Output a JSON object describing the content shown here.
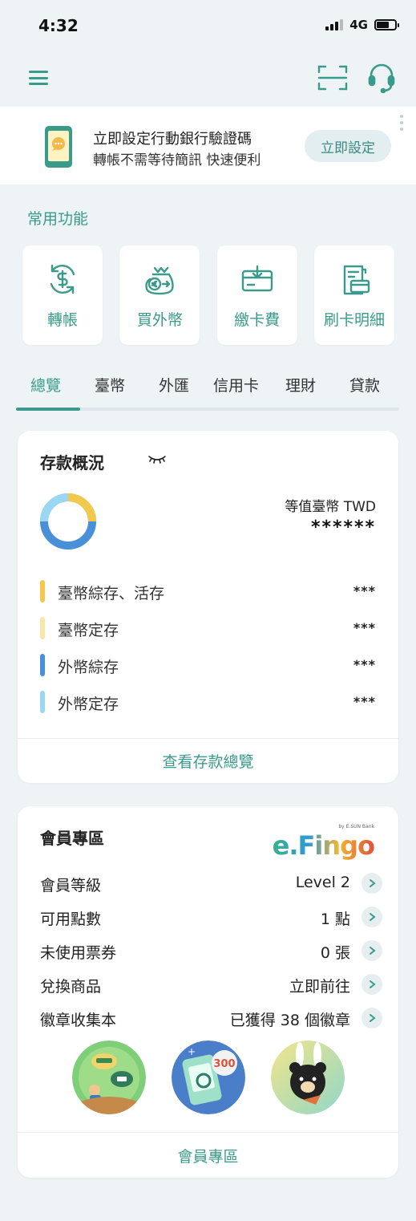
{
  "status_bar": {
    "time": "4:32",
    "network": "4G"
  },
  "banner": {
    "title": "立即設定行動銀行驗證碼",
    "subtitle": "轉帳不需等待簡訊 快速便利",
    "button": "立即設定"
  },
  "quick_functions": {
    "title": "常用功能",
    "items": [
      {
        "label": "轉帳",
        "icon": "transfer-dollar-icon"
      },
      {
        "label": "買外幣",
        "icon": "foreign-currency-icon"
      },
      {
        "label": "繳卡費",
        "icon": "pay-card-fee-icon"
      },
      {
        "label": "刷卡明細",
        "icon": "card-statement-icon"
      }
    ]
  },
  "tabs": [
    {
      "label": "總覽",
      "active": true
    },
    {
      "label": "臺幣"
    },
    {
      "label": "外匯"
    },
    {
      "label": "信用卡"
    },
    {
      "label": "理財"
    },
    {
      "label": "貸款"
    }
  ],
  "deposit": {
    "title": "存款概況",
    "currency_label": "等值臺幣 TWD",
    "total": "******",
    "rows": [
      {
        "label": "臺幣綜存、活存",
        "value": "***",
        "color": "#f2c94c"
      },
      {
        "label": "臺幣定存",
        "value": "***",
        "color": "#f8e7a8"
      },
      {
        "label": "外幣綜存",
        "value": "***",
        "color": "#4a90d9"
      },
      {
        "label": "外幣定存",
        "value": "***",
        "color": "#9ad7f2"
      }
    ],
    "link": "查看存款總覽"
  },
  "member": {
    "title": "會員專區",
    "logo_text": "e.Fingo",
    "logo_sub": "by E.SUN Bank",
    "rows": [
      {
        "label": "會員等級",
        "value": "Level 2"
      },
      {
        "label": "可用點數",
        "value": "1 點"
      },
      {
        "label": "未使用票券",
        "value": "0 張"
      },
      {
        "label": "兌換商品",
        "value": "立即前往"
      },
      {
        "label": "徽章收集本",
        "value": "已獲得 38 個徽章"
      }
    ],
    "badge_number": "300",
    "link": "會員專區"
  },
  "colors": {
    "accent": "#3a9b8c",
    "background": "#eef3f6"
  }
}
